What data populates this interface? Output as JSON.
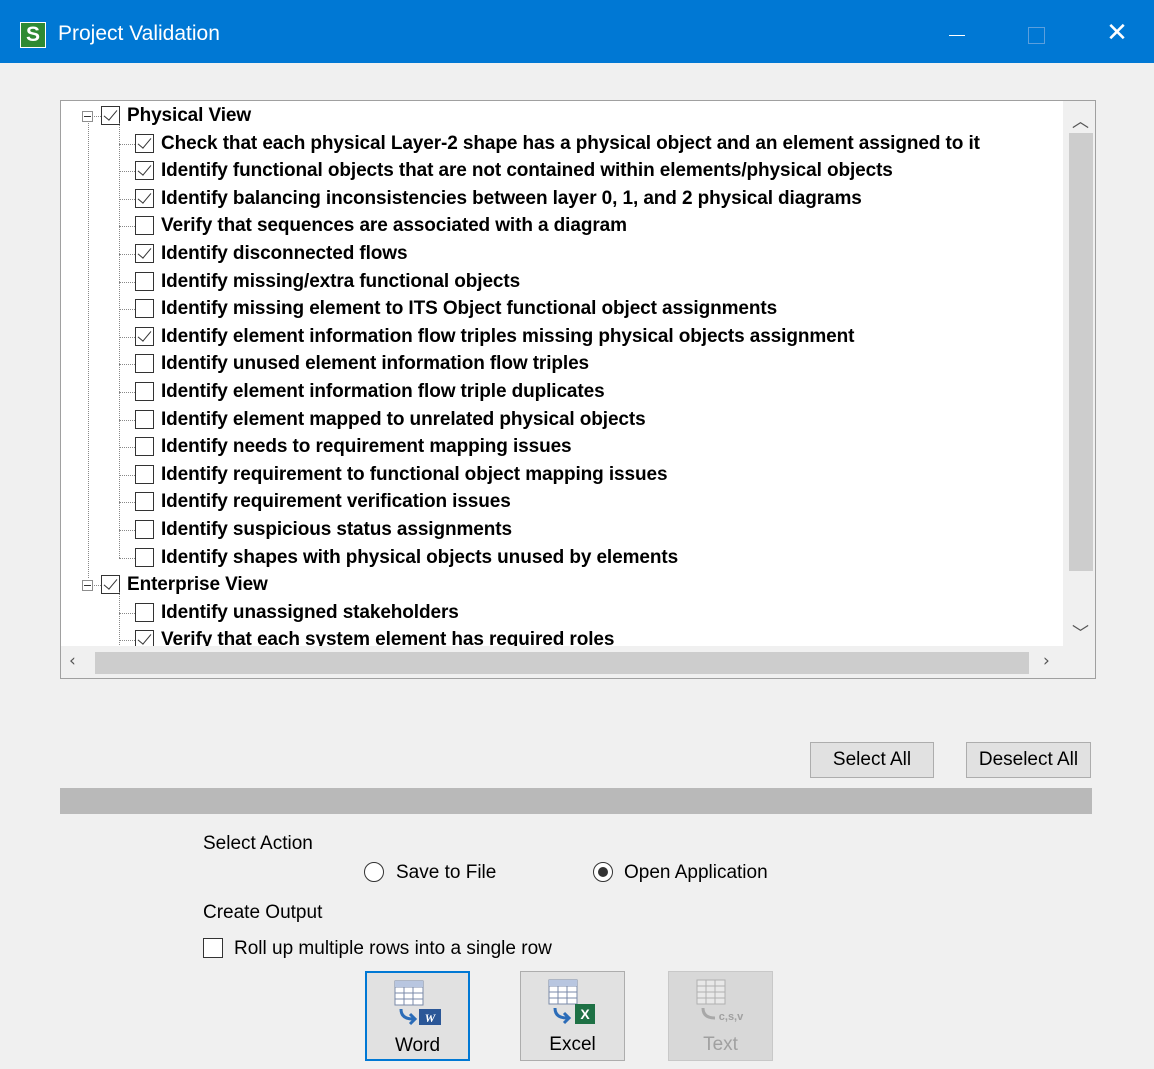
{
  "window": {
    "title": "Project Validation",
    "app_icon": "S",
    "close_glyph": "✕"
  },
  "tree": {
    "items": [
      {
        "label": "Physical View",
        "checked": true,
        "level": 0
      },
      {
        "label": "Check that each physical Layer-2 shape has a physical object and an element assigned to it",
        "checked": true,
        "level": 1
      },
      {
        "label": "Identify functional objects that are not contained within elements/physical objects",
        "checked": true,
        "level": 1
      },
      {
        "label": "Identify balancing inconsistencies between layer 0, 1, and 2 physical diagrams",
        "checked": true,
        "level": 1
      },
      {
        "label": "Verify that sequences are associated with a diagram",
        "checked": false,
        "level": 1
      },
      {
        "label": "Identify disconnected flows",
        "checked": true,
        "level": 1
      },
      {
        "label": "Identify missing/extra functional objects",
        "checked": false,
        "level": 1
      },
      {
        "label": "Identify missing element to ITS Object functional object assignments",
        "checked": false,
        "level": 1
      },
      {
        "label": "Identify element information flow triples missing physical objects assignment",
        "checked": true,
        "level": 1
      },
      {
        "label": "Identify unused element information flow triples",
        "checked": false,
        "level": 1
      },
      {
        "label": "Identify element information flow triple duplicates",
        "checked": false,
        "level": 1
      },
      {
        "label": "Identify element mapped to unrelated physical objects",
        "checked": false,
        "level": 1
      },
      {
        "label": "Identify needs to requirement mapping issues",
        "checked": false,
        "level": 1
      },
      {
        "label": "Identify requirement to functional object mapping issues",
        "checked": false,
        "level": 1
      },
      {
        "label": "Identify requirement verification issues",
        "checked": false,
        "level": 1
      },
      {
        "label": "Identify suspicious status assignments",
        "checked": false,
        "level": 1
      },
      {
        "label": "Identify shapes with physical objects unused by elements",
        "checked": false,
        "level": 1
      },
      {
        "label": "Enterprise View",
        "checked": true,
        "level": 0
      },
      {
        "label": "Identify unassigned stakeholders",
        "checked": false,
        "level": 1
      },
      {
        "label": "Verify that each system element has required roles",
        "checked": true,
        "level": 1
      }
    ]
  },
  "buttons": {
    "select_all": "Select All",
    "deselect_all": "Deselect All"
  },
  "action": {
    "heading": "Select Action",
    "save_to_file": "Save to File",
    "open_application": "Open Application",
    "selected": "open_application"
  },
  "output": {
    "heading": "Create Output",
    "rollup_label": "Roll up multiple rows into a single row",
    "rollup_checked": false,
    "word": "Word",
    "excel": "Excel",
    "text": "Text"
  },
  "colors": {
    "titlebar": "#0078d4",
    "accent": "#0078d4",
    "window_bg": "#f0f0f0"
  }
}
